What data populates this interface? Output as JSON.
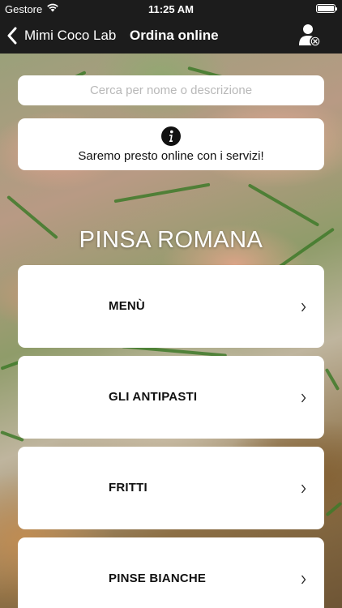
{
  "status_bar": {
    "carrier": "Gestore",
    "time": "11:25 AM"
  },
  "nav": {
    "back_label": "Mimi Coco Lab",
    "title": "Ordina online",
    "icons": {
      "back": "chevron-left-icon",
      "account": "user-logout-icon"
    }
  },
  "search": {
    "placeholder": "Cerca per nome o descrizione",
    "value": ""
  },
  "info": {
    "icon": "info-icon",
    "message": "Saremo presto online con i servizi!"
  },
  "restaurant": {
    "name": "PINSA ROMANA"
  },
  "categories": [
    {
      "label": "MENÙ"
    },
    {
      "label": "GLI ANTIPASTI"
    },
    {
      "label": "FRITTI"
    },
    {
      "label": "PINSE BIANCHE"
    }
  ],
  "colors": {
    "bar_background": "#1c1c1c",
    "card_background": "#ffffff",
    "text_primary": "#111111",
    "placeholder": "#b8b8b8"
  }
}
